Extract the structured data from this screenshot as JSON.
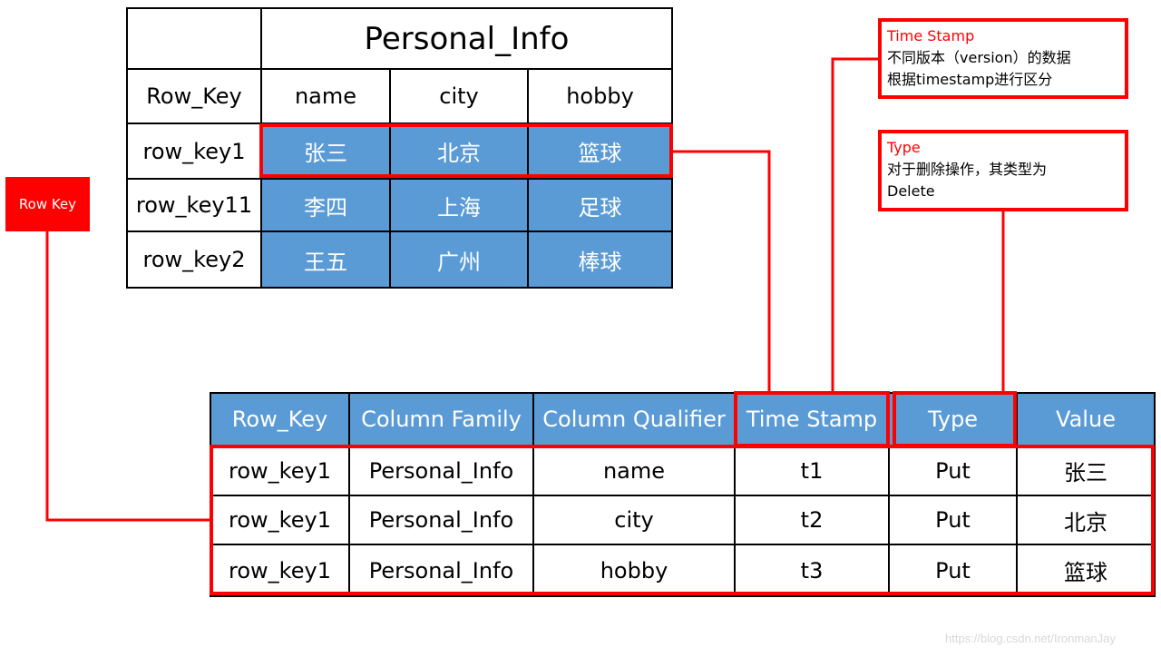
{
  "top_table": {
    "title": "Personal_Info",
    "headers": [
      "Row_Key",
      "name",
      "city",
      "hobby"
    ],
    "rows": [
      [
        "row_key1",
        "张三",
        "北京",
        "篮球"
      ],
      [
        "row_key11",
        "李四",
        "上海",
        "足球"
      ],
      [
        "row_key2",
        "王五",
        "广州",
        "棒球"
      ]
    ]
  },
  "row_key_label": "Row Key",
  "bottom_table": {
    "headers": [
      "Row_Key",
      "Column Family",
      "Column Qualifier",
      "Time Stamp",
      "Type",
      "Value"
    ],
    "rows": [
      [
        "row_key1",
        "Personal_Info",
        "name",
        "t1",
        "Put",
        "张三"
      ],
      [
        "row_key1",
        "Personal_Info",
        "city",
        "t2",
        "Put",
        "北京"
      ],
      [
        "row_key1",
        "Personal_Info",
        "hobby",
        "t3",
        "Put",
        "篮球"
      ]
    ]
  },
  "callouts": {
    "timestamp": {
      "title": "Time Stamp",
      "line1": "不同版本（version）的数据",
      "line2": "根据timestamp进行区分"
    },
    "type": {
      "title": "Type",
      "line1": "对于删除操作，其类型为",
      "line2": "Delete"
    }
  },
  "watermark": "https://blog.csdn.net/IronmanJay",
  "colors": {
    "cell_blue": "#5b9bd5",
    "highlight_red": "#ff0000"
  }
}
